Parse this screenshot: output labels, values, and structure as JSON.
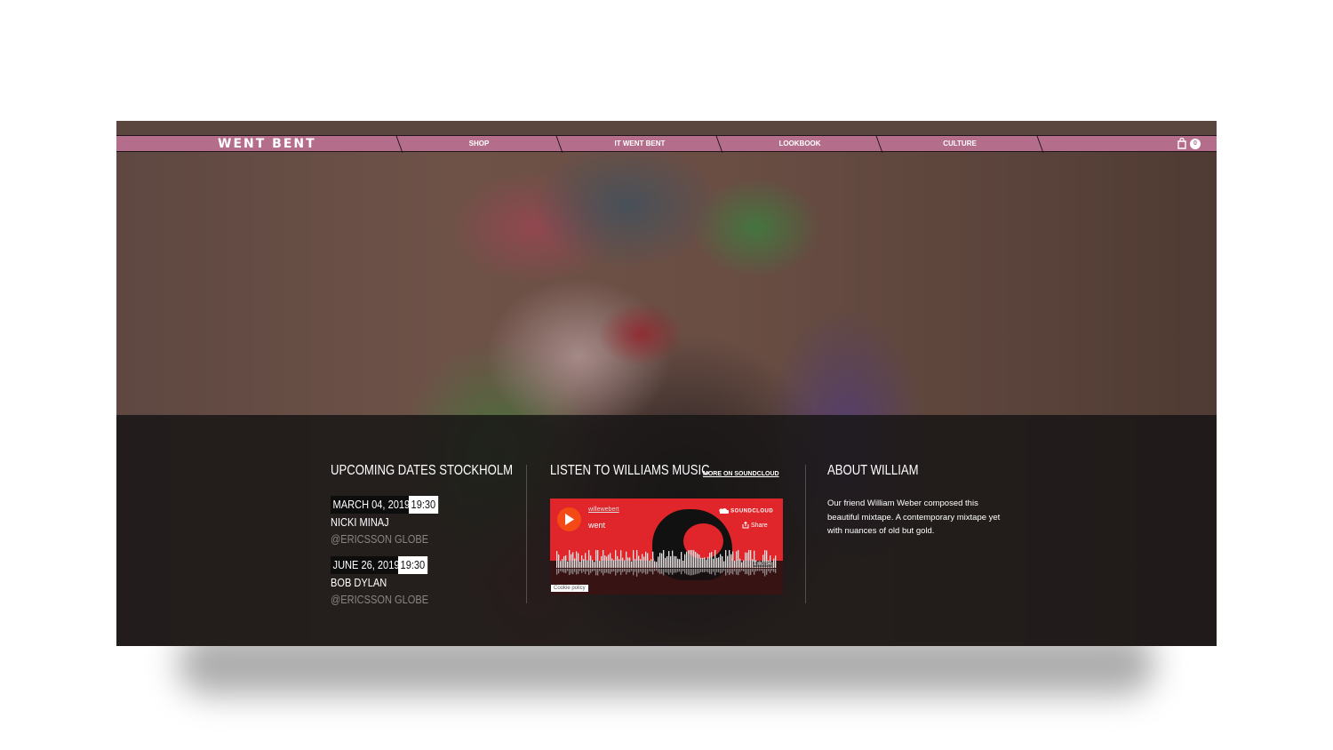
{
  "brand": {
    "logo": "WENT BENT",
    "accent": "#b46d8b"
  },
  "nav": {
    "items": [
      {
        "label": "SHOP"
      },
      {
        "label": "IT WENT BENT"
      },
      {
        "label": "LOOKBOOK"
      },
      {
        "label": "CULTURE"
      }
    ],
    "cart": {
      "icon": "shopping-bag-icon",
      "count": "0"
    }
  },
  "upcoming": {
    "title": "UPCOMING DATES STOCKHOLM",
    "events": [
      {
        "date": "MARCH 04, 2019",
        "time": "19:30",
        "artist": "NICKI MINAJ",
        "venue": "@ERICSSON GLOBE"
      },
      {
        "date": "JUNE 26, 2019",
        "time": "19:30",
        "artist": "BOB DYLAN",
        "venue": "@ERICSSON GLOBE"
      }
    ]
  },
  "music": {
    "title": "LISTEN TO WILLIAMS MUSIC",
    "more_link": "MORE ON SOUNDCLOUD",
    "player": {
      "user": "willewebert",
      "track": "went",
      "brand": "SOUNDCLOUD",
      "share": "Share",
      "duration": "1:00:54",
      "cookie_policy": "Cookie policy",
      "accent": "#e0262b",
      "play_color": "#f44b16"
    }
  },
  "about": {
    "title": "ABOUT WILLIAM",
    "text": "Our friend William Weber composed this beautiful mixtape. A contemporary mixtape yet with nuances of old but gold."
  }
}
